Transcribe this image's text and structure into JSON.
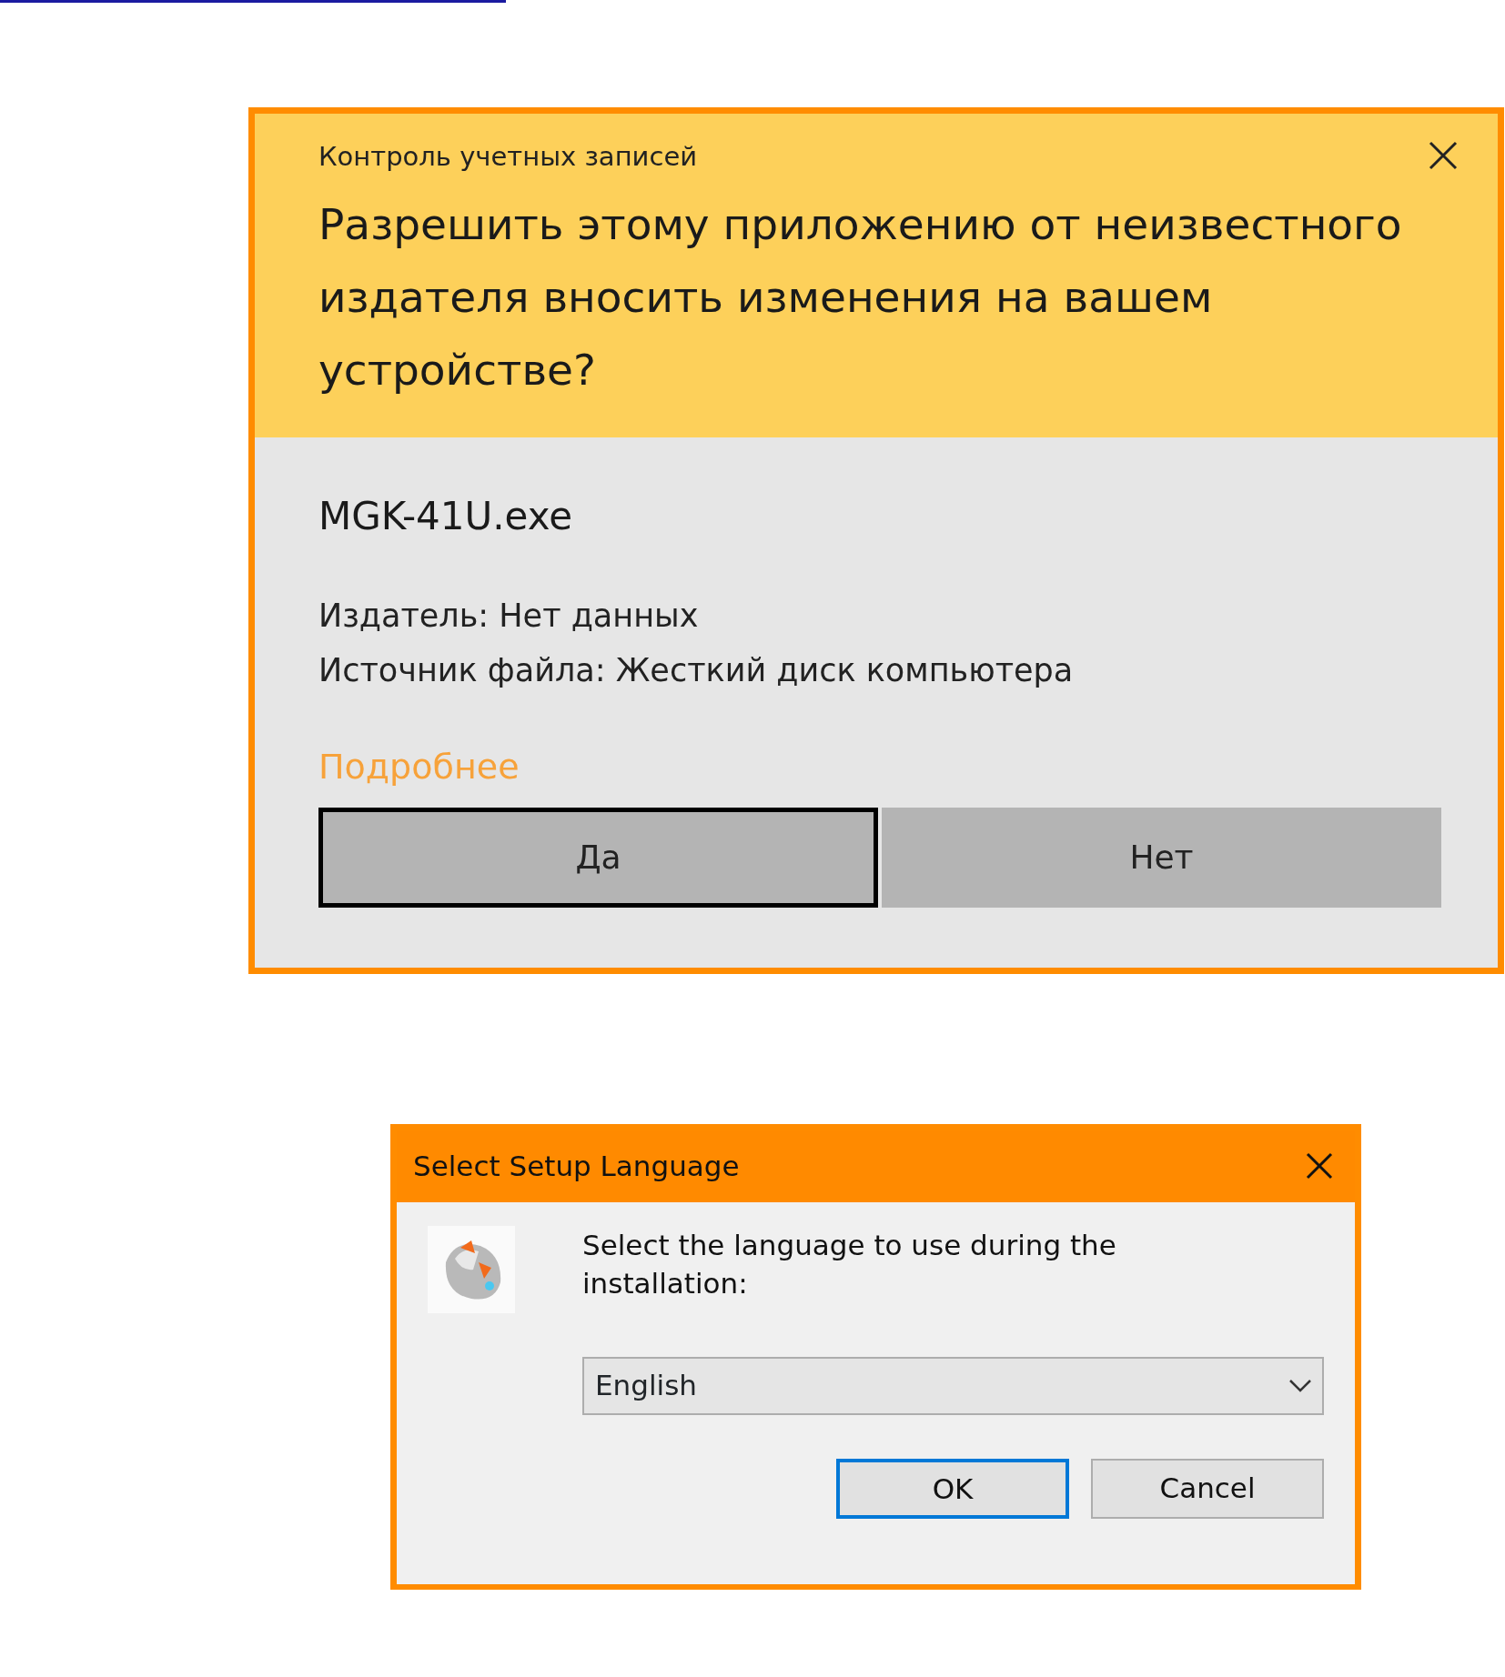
{
  "uac_dialog": {
    "title": "Контроль учетных записей",
    "question": "Разрешить этому приложению от неизвестного издателя вносить изменения на вашем устройстве?",
    "program": "MGK-41U.exe",
    "details": [
      "Издатель: Нет данных",
      "Источник файла: Жесткий диск компьютера"
    ],
    "more_link": "Подробнее",
    "buttons": [
      {
        "label": "Да",
        "selected": true
      },
      {
        "label": "Нет",
        "selected": false
      }
    ]
  },
  "setup_dialog": {
    "title": "Select Setup Language",
    "prompt": "Select the language to use during the installation:",
    "language": "English",
    "buttons": [
      {
        "label": "OK",
        "selected": true
      },
      {
        "label": "Cancel",
        "selected": false
      }
    ]
  }
}
